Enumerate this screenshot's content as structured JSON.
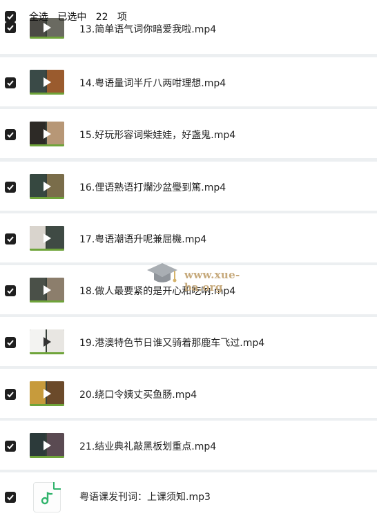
{
  "header": {
    "select_all": "全选",
    "selected_prefix": "已选中",
    "selected_count": "22",
    "selected_suffix": "项"
  },
  "items": [
    {
      "label": "13.简单语气词你暗爱我啦.mp4",
      "type": "video",
      "checked": true
    },
    {
      "label": "14.粤语量词半斤八两咁理想.mp4",
      "type": "video",
      "checked": true
    },
    {
      "label": "15.好玩形容词柴娃娃，好盏鬼.mp4",
      "type": "video",
      "checked": true
    },
    {
      "label": "16.俚语熟语打爛沙盆璺到篤.mp4",
      "type": "video",
      "checked": true
    },
    {
      "label": "17.粤语潮语升呢兼屈機.mp4",
      "type": "video",
      "checked": true
    },
    {
      "label": "18.做人最要紧的是开心和吃呐.mp4",
      "type": "video",
      "checked": true
    },
    {
      "label": "19.港澳特色节日谁又骑着那鹿车飞过.mp4",
      "type": "video",
      "checked": true
    },
    {
      "label": "20.绕口令姨丈买鱼肠.mp4",
      "type": "video",
      "checked": true
    },
    {
      "label": "21.结业典礼敲黑板划重点.mp4",
      "type": "video",
      "checked": true
    },
    {
      "label": "粤语课发刊词：上课须知.mp3",
      "type": "audio",
      "checked": true
    }
  ],
  "watermark": {
    "text": "www.xue-ba.org"
  },
  "colors": {
    "accent_green": "#2fb36b",
    "checkbox": "#1f1f1f",
    "watermark": "#c6a97b"
  }
}
